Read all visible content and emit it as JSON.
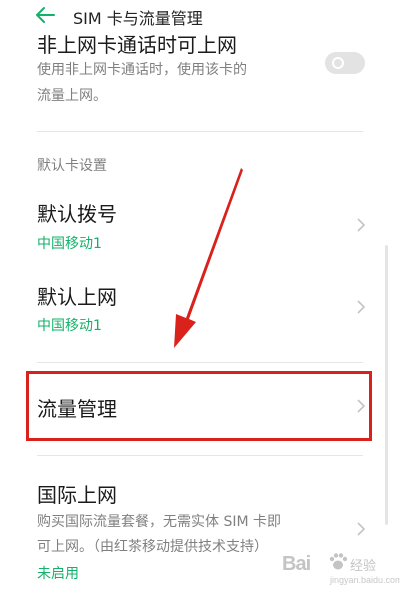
{
  "header": {
    "title": "SIM 卡与流量管理",
    "back_icon": "arrow-left-icon",
    "back_color": "#12b26a"
  },
  "non_data_call": {
    "title": "非上网卡通话时可上网",
    "description_line1": "使用非上网卡通话时，使用该卡的",
    "description_line2": "流量上网。",
    "toggle_on": false
  },
  "default_card": {
    "section_label": "默认卡设置",
    "dial": {
      "title": "默认拨号",
      "value": "中国移动1"
    },
    "data": {
      "title": "默认上网",
      "value": "中国移动1"
    }
  },
  "traffic": {
    "title": "流量管理"
  },
  "international": {
    "title": "国际上网",
    "description_line1": "购买国际流量套餐，无需实体 SIM 卡即",
    "description_line2": "可上网。（由红茶移动提供技术支持）",
    "status": "未启用"
  },
  "annotation": {
    "highlight_color": "#d9221c",
    "arrow_color": "#d9221c"
  },
  "watermark": {
    "brand": "Bai",
    "text": "经验",
    "url": "jingyan.baidu.com"
  },
  "colors": {
    "accent": "#12b26a",
    "secondary_text": "#808080",
    "divider": "#e6e6e6"
  }
}
